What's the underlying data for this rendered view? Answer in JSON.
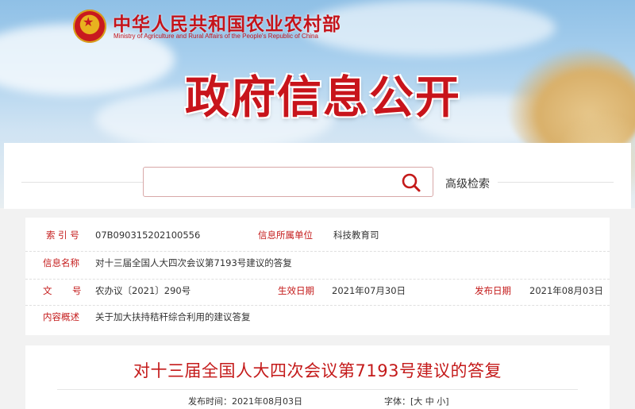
{
  "header": {
    "ministry_cn": "中华人民共和国农业农村部",
    "ministry_en": "Ministry of Agriculture and Rural Affairs of the People's Republic of China",
    "banner_title": "政府信息公开",
    "accent_color": "#c8141b"
  },
  "search": {
    "placeholder": "",
    "icon": "search-icon",
    "advanced_label": "高级检索"
  },
  "info": {
    "index_label": "索 引 号",
    "index_value": "07B090315202100556",
    "unit_label": "信息所属单位",
    "unit_value": "科技教育司",
    "name_label": "信息名称",
    "name_value": "对十三届全国人大四次会议第7193号建议的答复",
    "doc_label_1": "文",
    "doc_label_2": "号",
    "doc_value": "农办议〔2021〕290号",
    "effective_label": "生效日期",
    "effective_value": "2021年07月30日",
    "publish_label": "发布日期",
    "publish_value": "2021年08月03日",
    "summary_label": "内容概述",
    "summary_value": "关于加大扶持秸秆综合利用的建议答复"
  },
  "article": {
    "title": "对十三届全国人大四次会议第7193号建议的答复",
    "publish_time_label": "发布时间：",
    "publish_time": "2021年08月03日",
    "font_label": "字体：",
    "bracket_open": "[",
    "font_large": "大",
    "font_medium": "中",
    "font_small": "小",
    "bracket_close": "]"
  }
}
